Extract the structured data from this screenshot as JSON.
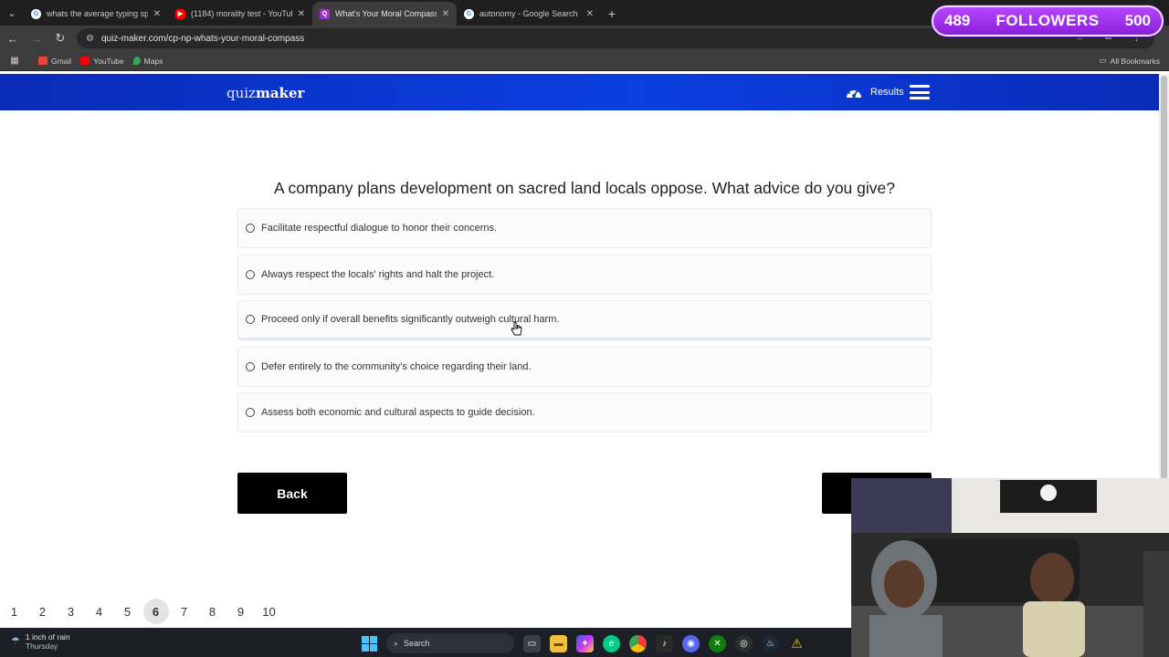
{
  "browser": {
    "tabs": [
      {
        "title": "whats the average typing spee",
        "favicon": "google-icon",
        "color": "#4285f4",
        "active": false
      },
      {
        "title": "(1184) morality test - YouTube",
        "favicon": "youtube-icon",
        "color": "#ff0000",
        "active": false
      },
      {
        "title": "What's Your Moral Compass? T",
        "favicon": "quizmaker-icon",
        "color": "#9b38c7",
        "active": true
      },
      {
        "title": "autonomy - Google Search",
        "favicon": "google-icon",
        "color": "#4285f4",
        "active": false
      }
    ],
    "url": "quiz-maker.com/cp-np-whats-your-moral-compass",
    "bookmarks": [
      {
        "label": "Gmail",
        "icon": "gmail-icon"
      },
      {
        "label": "YouTube",
        "icon": "youtube-icon"
      },
      {
        "label": "Maps",
        "icon": "maps-icon"
      }
    ],
    "all_bookmarks": "All Bookmarks"
  },
  "overlay": {
    "current": "489",
    "label": "FOLLOWERS",
    "goal": "500"
  },
  "site": {
    "logo_light": "quiz",
    "logo_bold": "maker",
    "results_label": "Results"
  },
  "quiz": {
    "question": "A company plans development on sacred land locals oppose. What advice do you give?",
    "options": [
      "Facilitate respectful dialogue to honor their concerns.",
      "Always respect the locals' rights and halt the project.",
      "Proceed only if overall benefits significantly outweigh cultural harm.",
      "Defer entirely to the community's choice regarding their land.",
      "Assess both economic and cultural aspects to guide decision."
    ],
    "back_label": "Back"
  },
  "pagination": {
    "pages": [
      "1",
      "2",
      "3",
      "4",
      "5",
      "6",
      "7",
      "8",
      "9",
      "10"
    ],
    "current": "6"
  },
  "taskbar": {
    "weather_main": "1 inch of rain",
    "weather_sub": "Thursday",
    "search_label": "Search"
  }
}
